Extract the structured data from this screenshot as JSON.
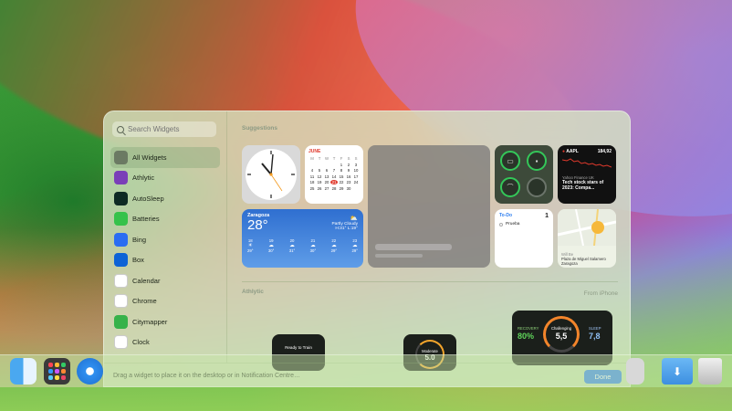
{
  "search": {
    "placeholder": "Search Widgets"
  },
  "sidebar": {
    "items": [
      {
        "label": "All Widgets",
        "icon": "all-widgets-icon",
        "color": "#6b7a63"
      },
      {
        "label": "Athlytic",
        "icon": "athlytic-icon",
        "color": "#7a3fb8"
      },
      {
        "label": "AutoSleep",
        "icon": "autosleep-icon",
        "color": "#0e2a24"
      },
      {
        "label": "Batteries",
        "icon": "battery-icon",
        "color": "#35c24a"
      },
      {
        "label": "Bing",
        "icon": "bing-icon",
        "color": "#2a6df2"
      },
      {
        "label": "Box",
        "icon": "box-icon",
        "color": "#0d63d6"
      },
      {
        "label": "Calendar",
        "icon": "calendar-icon",
        "color": "#ffffff"
      },
      {
        "label": "Chrome",
        "icon": "chrome-icon",
        "color": "#ffffff"
      },
      {
        "label": "Citymapper",
        "icon": "citymapper-icon",
        "color": "#37b24a"
      },
      {
        "label": "Clock",
        "icon": "clock-icon",
        "color": "#ffffff"
      }
    ]
  },
  "sections": {
    "suggestions": "Suggestions",
    "athlytic": "Athlytic",
    "from_iphone": "From iPhone"
  },
  "calendar": {
    "month": "JUNE",
    "days": [
      "M",
      "T",
      "W",
      "T",
      "F",
      "S",
      "S"
    ],
    "dates": [
      "",
      "",
      "",
      "",
      "1",
      "2",
      "3",
      "4",
      "5",
      "6",
      "7",
      "8",
      "9",
      "10",
      "11",
      "12",
      "13",
      "14",
      "15",
      "16",
      "17",
      "18",
      "19",
      "20",
      "21",
      "22",
      "23",
      "24",
      "25",
      "26",
      "27",
      "28",
      "29",
      "30"
    ],
    "today": "21"
  },
  "weather": {
    "city": "Zaragoza",
    "temp": "28°",
    "condition": "Partly Cloudy",
    "hilo": "H:31° L:19°",
    "hours": [
      "18",
      "19",
      "20",
      "21",
      "22",
      "23"
    ],
    "temps": [
      "29°",
      "30°",
      "31°",
      "30°",
      "29°",
      "29°"
    ]
  },
  "stocks": {
    "ticker": "AAPL",
    "price": "184,92",
    "source": "Yahoo Finance UK",
    "headline": "Tech stock stars of 2023: Compa..."
  },
  "todo": {
    "title": "To-Do",
    "count": "1",
    "task": "Prueba"
  },
  "maps": {
    "label": "Will Be",
    "place": "Plaza de Miguel Salamero",
    "city": "Zaragoza"
  },
  "athlytic": {
    "w1": "Ready to Train",
    "w2": "Moderate",
    "w2_val": "5.0",
    "recovery_label": "RECOVERY",
    "recovery": "80%",
    "challenging_label": "Challenging",
    "challenging": "5,5",
    "sleep_label": "SLEEP",
    "sleep": "7,8"
  },
  "footer": {
    "hint": "Drag a widget to place it on the desktop or in Notification Centre…",
    "done": "Done"
  }
}
